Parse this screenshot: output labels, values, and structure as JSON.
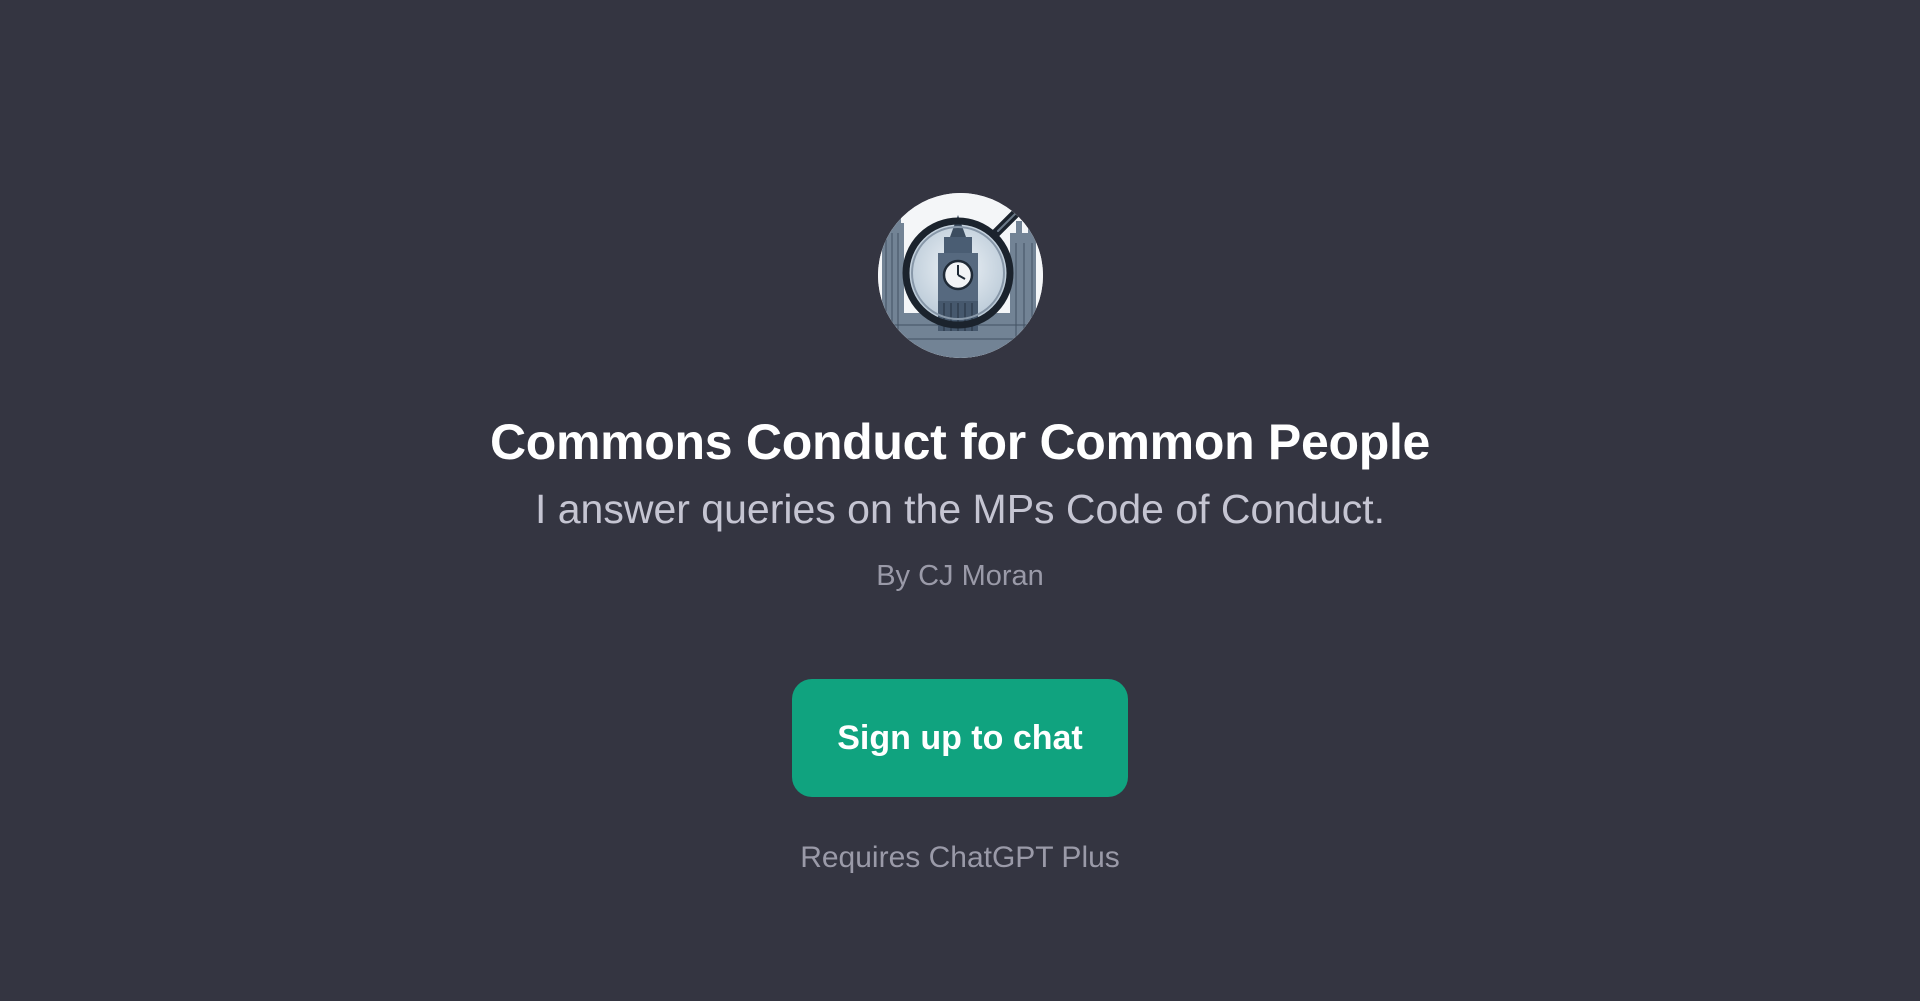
{
  "gpt": {
    "avatar_icon": "big-ben-magnifying-glass-icon",
    "title": "Commons Conduct for Common People",
    "description": "I answer queries on the MPs Code of Conduct.",
    "author": "By CJ Moran"
  },
  "actions": {
    "signup_label": "Sign up to chat",
    "requirement_note": "Requires ChatGPT Plus"
  },
  "colors": {
    "background": "#343541",
    "accent": "#10a37f",
    "title_text": "#ffffff",
    "subtitle_text": "#c5c5d2",
    "muted_text": "#9a9aa8"
  }
}
